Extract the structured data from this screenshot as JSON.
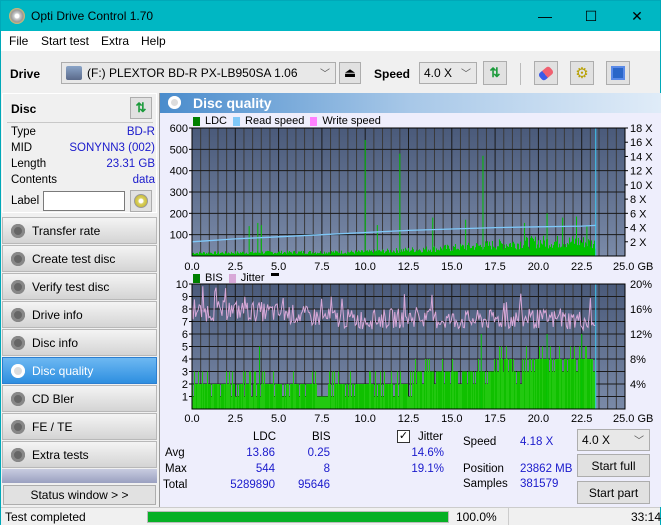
{
  "window": {
    "title": "Opti Drive Control 1.70",
    "minimize": "—",
    "maximize": "☐",
    "close": "✕"
  },
  "menu": [
    "File",
    "Start test",
    "Extra",
    "Help"
  ],
  "toolbar": {
    "drive_label": "Drive",
    "drive_value": "(F:)  PLEXTOR BD-R  PX-LB950SA 1.06",
    "speed_label": "Speed",
    "speed_value": "4.0 X"
  },
  "disc": {
    "header": "Disc",
    "rows": [
      {
        "key": "Type",
        "value": "BD-R"
      },
      {
        "key": "MID",
        "value": "SONYNN3 (002)"
      },
      {
        "key": "Length",
        "value": "23.31 GB"
      },
      {
        "key": "Contents",
        "value": "data"
      }
    ],
    "label_key": "Label",
    "label_value": ""
  },
  "nav": [
    {
      "label": "Transfer rate",
      "active": false
    },
    {
      "label": "Create test disc",
      "active": false
    },
    {
      "label": "Verify test disc",
      "active": false
    },
    {
      "label": "Drive info",
      "active": false
    },
    {
      "label": "Disc info",
      "active": false
    },
    {
      "label": "Disc quality",
      "active": true
    },
    {
      "label": "CD Bler",
      "active": false
    },
    {
      "label": "FE / TE",
      "active": false
    },
    {
      "label": "Extra tests",
      "active": false
    }
  ],
  "status_window_button": "Status window > >",
  "panel_title": "Disc quality",
  "colors": {
    "ldc": "#00c000",
    "read_speed": "#7fc8f8",
    "write_speed": "#ff80ff",
    "bis": "#00c000",
    "jitter": "#d8a8d8",
    "plot_bg_top": "#4a5a7a",
    "plot_bg_bottom": "#7a8aa8",
    "progress": "#06b025"
  },
  "chart_data": [
    {
      "type": "bar",
      "title": "LDC / Read speed",
      "legend": [
        "LDC",
        "Read speed",
        "Write speed"
      ],
      "xlabel": "GB",
      "x_ticks": [
        "0.0",
        "2.5",
        "5.0",
        "7.5",
        "10.0",
        "12.5",
        "15.0",
        "17.5",
        "20.0",
        "22.5",
        "25.0 GB"
      ],
      "xlim": [
        0,
        25
      ],
      "y_ticks": [
        "100",
        "200",
        "300",
        "400",
        "500",
        "600"
      ],
      "ylim": [
        0,
        600
      ],
      "y2_ticks": [
        "2 X",
        "4 X",
        "6 X",
        "8 X",
        "10 X",
        "12 X",
        "14 X",
        "16 X",
        "18 X"
      ],
      "y2lim": [
        0,
        18
      ],
      "data_end_gb": 23.31,
      "ldc_baseline": [
        [
          0,
          15
        ],
        [
          5,
          18
        ],
        [
          10,
          20
        ],
        [
          12.5,
          30
        ],
        [
          15,
          40
        ],
        [
          17.5,
          55
        ],
        [
          20,
          70
        ],
        [
          22.5,
          70
        ],
        [
          23.31,
          60
        ]
      ],
      "ldc_spikes": [
        [
          3.3,
          140
        ],
        [
          3.8,
          155
        ],
        [
          4.0,
          145
        ],
        [
          10.0,
          544
        ],
        [
          10.7,
          145
        ],
        [
          12.0,
          480
        ],
        [
          13.9,
          180
        ],
        [
          15.8,
          170
        ],
        [
          16.8,
          470
        ],
        [
          19.2,
          155
        ],
        [
          20.5,
          200
        ],
        [
          21.4,
          180
        ],
        [
          22.2,
          185
        ],
        [
          22.8,
          140
        ]
      ],
      "read_speed": [
        [
          0,
          2.0
        ],
        [
          2.5,
          2.4
        ],
        [
          5,
          2.7
        ],
        [
          7.5,
          3.0
        ],
        [
          10,
          3.3
        ],
        [
          12.5,
          3.6
        ],
        [
          15,
          3.8
        ],
        [
          17.5,
          4.0
        ],
        [
          20,
          4.1
        ],
        [
          22.5,
          4.2
        ],
        [
          23.31,
          4.3
        ]
      ]
    },
    {
      "type": "bar",
      "title": "BIS / Jitter",
      "legend": [
        "BIS",
        "Jitter"
      ],
      "xlabel": "GB",
      "x_ticks": [
        "0.0",
        "2.5",
        "5.0",
        "7.5",
        "10.0",
        "12.5",
        "15.0",
        "17.5",
        "20.0",
        "22.5",
        "25.0 GB"
      ],
      "xlim": [
        0,
        25
      ],
      "y_ticks": [
        "1",
        "2",
        "3",
        "4",
        "5",
        "6",
        "7",
        "8",
        "9",
        "10"
      ],
      "ylim": [
        0,
        10
      ],
      "y2_ticks": [
        "4%",
        "8%",
        "12%",
        "16%",
        "20%"
      ],
      "y2lim": [
        0,
        20
      ],
      "data_end_gb": 23.31,
      "bis_levels": [
        [
          0,
          2
        ],
        [
          7.2,
          1
        ],
        [
          7.8,
          2
        ],
        [
          12.7,
          3
        ],
        [
          17.5,
          4
        ],
        [
          18.5,
          3
        ],
        [
          19.0,
          4
        ],
        [
          23.31,
          3
        ]
      ],
      "bis_spikes": [
        [
          3.9,
          5
        ],
        [
          16.7,
          6
        ],
        [
          20.5,
          6
        ],
        [
          22.5,
          6
        ]
      ],
      "jitter_mean_pct": [
        [
          0,
          15.5
        ],
        [
          2.5,
          15.8
        ],
        [
          5,
          15.4
        ],
        [
          7.5,
          14.6
        ],
        [
          10,
          14.3
        ],
        [
          12.5,
          14.6
        ],
        [
          15,
          14.2
        ],
        [
          17.5,
          14.3
        ],
        [
          20,
          14.4
        ],
        [
          22.5,
          14.2
        ],
        [
          23.31,
          13.8
        ]
      ]
    }
  ],
  "stats": {
    "col_ldc": "LDC",
    "col_bis": "BIS",
    "jitter_label": "Jitter",
    "jitter_checked": true,
    "rows": [
      {
        "label": "Avg",
        "ldc": "13.86",
        "bis": "0.25",
        "jitter": "14.6%"
      },
      {
        "label": "Max",
        "ldc": "544",
        "bis": "8",
        "jitter": "19.1%"
      },
      {
        "label": "Total",
        "ldc": "5289890",
        "bis": "95646",
        "jitter": ""
      }
    ],
    "speed_label": "Speed",
    "speed_value": "4.18 X",
    "position_label": "Position",
    "position_value": "23862 MB",
    "samples_label": "Samples",
    "samples_value": "381579",
    "speed_select": "4.0 X",
    "start_full": "Start full",
    "start_part": "Start part"
  },
  "statusbar": {
    "text": "Test completed",
    "progress_pct": 100.0,
    "progress_text": "100.0%",
    "time": "33:14"
  }
}
